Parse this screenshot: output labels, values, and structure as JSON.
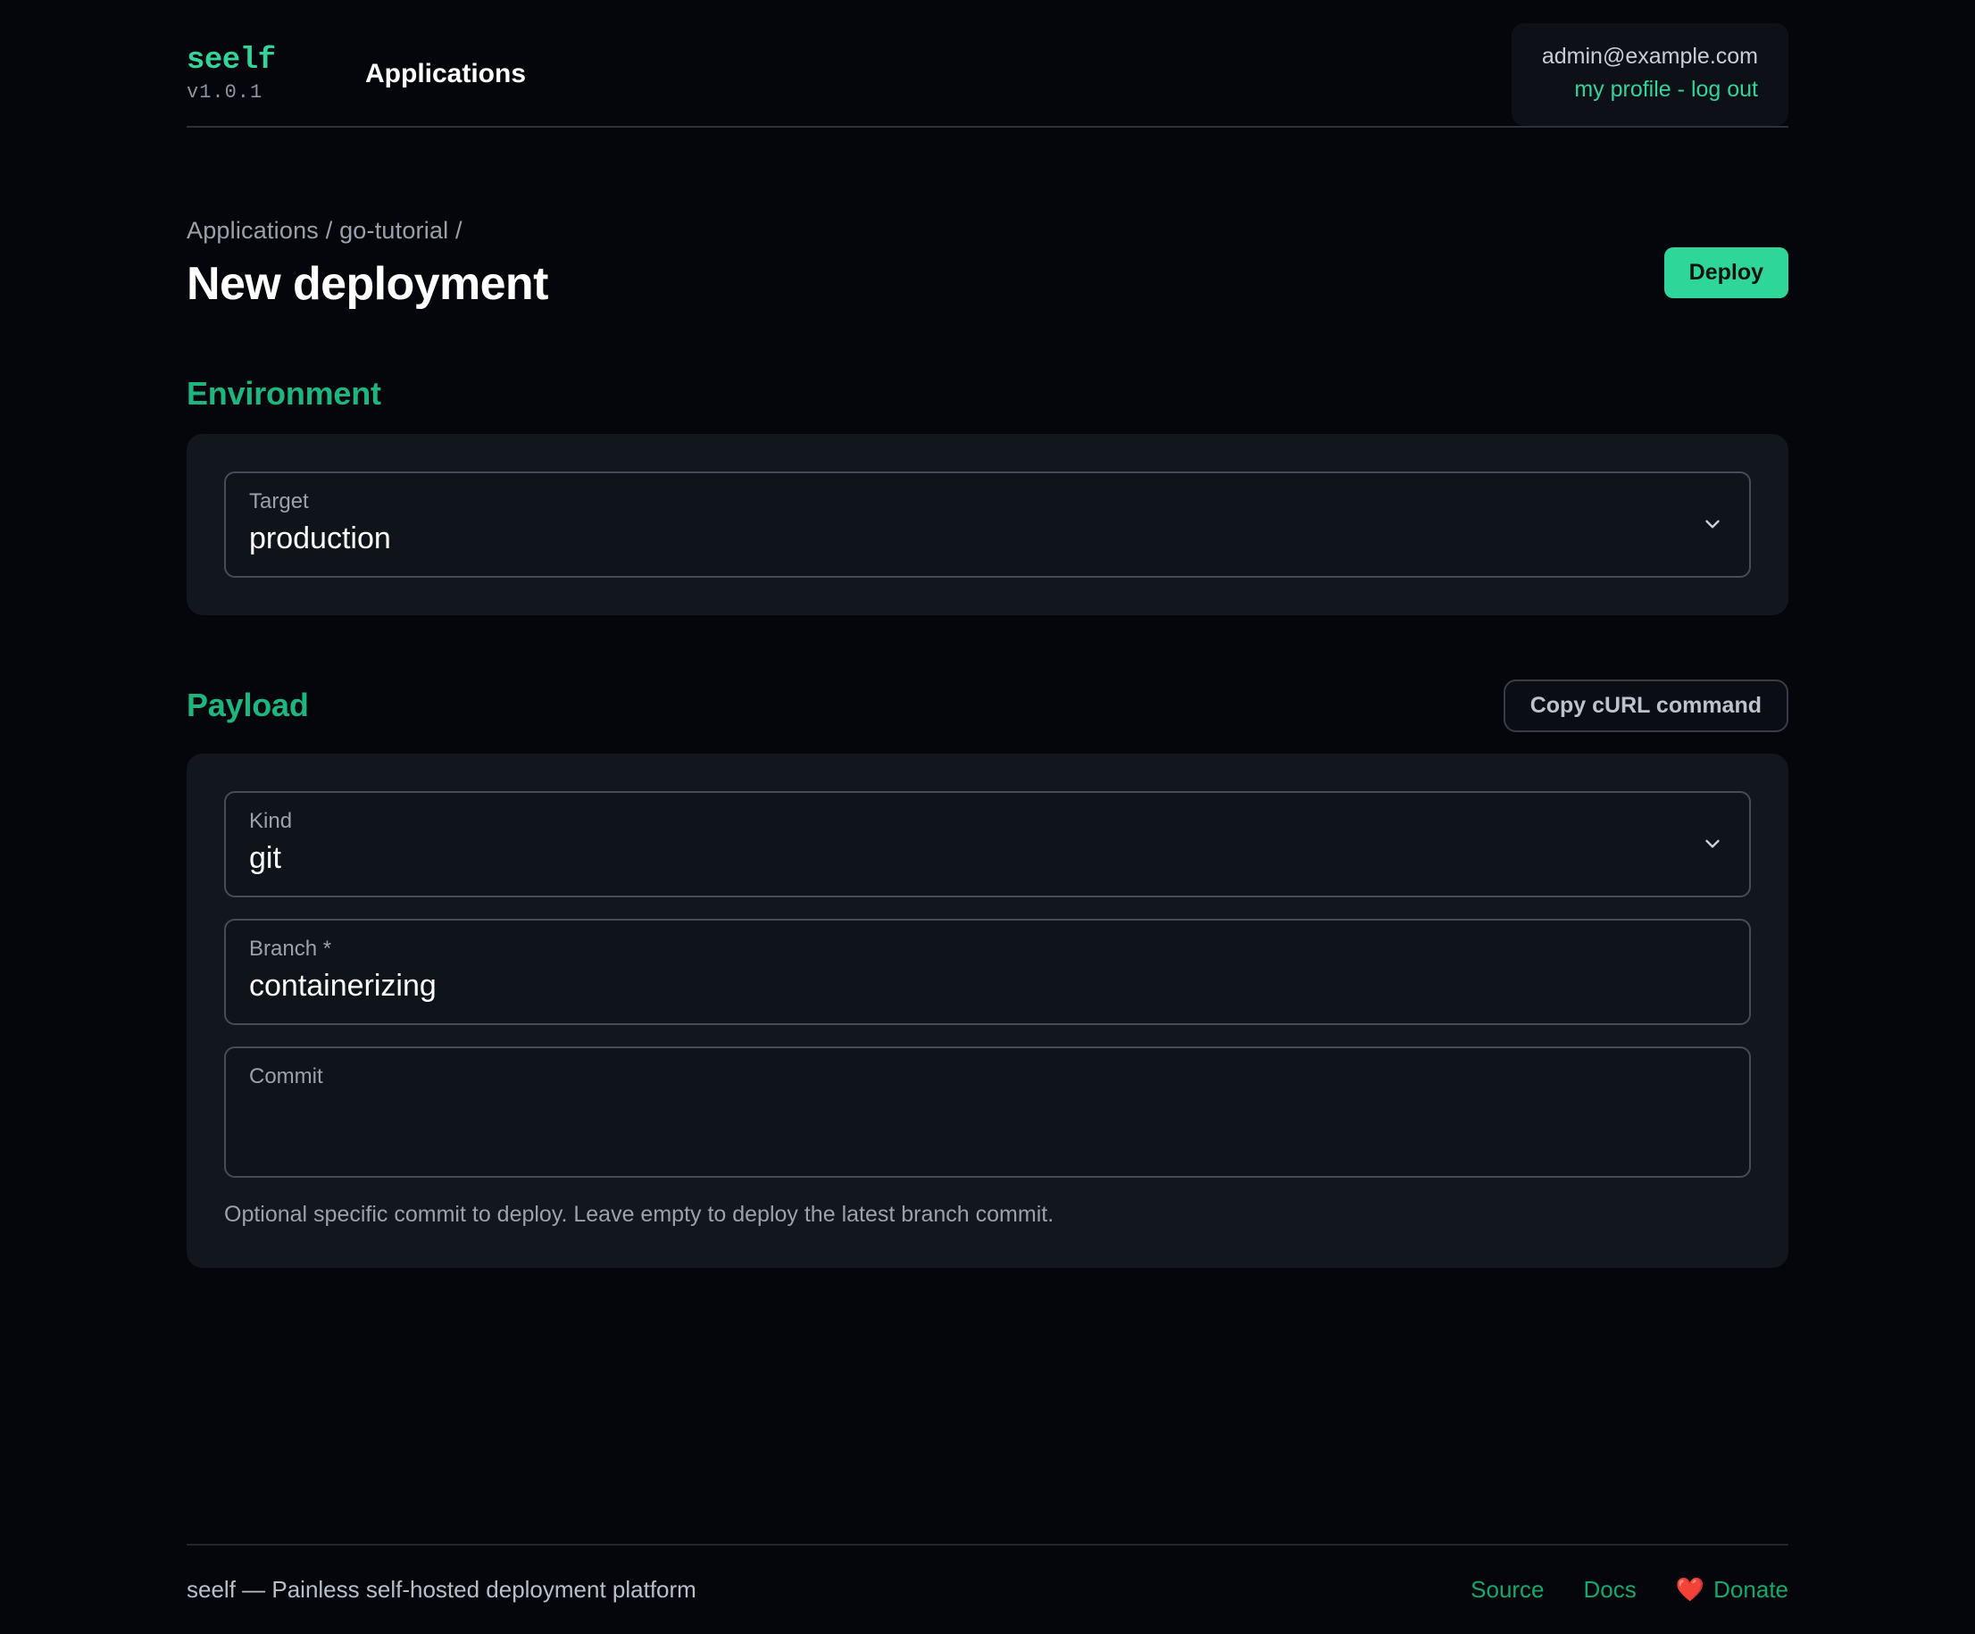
{
  "header": {
    "brand_name": "seelf",
    "brand_version": "v1.0.1",
    "nav_title": "Applications",
    "user_email": "admin@example.com",
    "profile_link": "my profile",
    "link_separator": "-",
    "logout_link": "log out"
  },
  "page": {
    "breadcrumb": "Applications / go-tutorial /",
    "title": "New deployment",
    "deploy_label": "Deploy"
  },
  "environment": {
    "section_title": "Environment",
    "target": {
      "label": "Target",
      "value": "production",
      "icon": "chevron-down-icon"
    }
  },
  "payload": {
    "section_title": "Payload",
    "copy_curl_label": "Copy cURL command",
    "kind": {
      "label": "Kind",
      "value": "git",
      "icon": "chevron-down-icon"
    },
    "branch": {
      "label": "Branch *",
      "value": "containerizing"
    },
    "commit": {
      "label": "Commit",
      "value": "",
      "hint": "Optional specific commit to deploy. Leave empty to deploy the latest branch commit."
    }
  },
  "footer": {
    "text": "seelf — Painless self-hosted deployment platform",
    "source_label": "Source",
    "docs_label": "Docs",
    "donate_label": "Donate",
    "heart_icon": "❤️"
  },
  "colors": {
    "accent": "#34d399",
    "accent_dark": "#1db67f",
    "deploy_button": "#2ed699",
    "background": "#05060c",
    "card": "#12161d"
  }
}
